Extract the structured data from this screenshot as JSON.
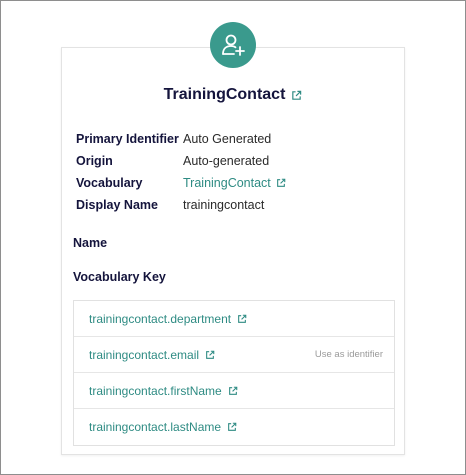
{
  "contact": {
    "title": "TrainingContact",
    "avatar_color": "#3a9a8d",
    "link_color": "#2e8b83"
  },
  "properties": [
    {
      "label": "Primary Identifier",
      "value": "Auto Generated"
    },
    {
      "label": "Origin",
      "value": "Auto-generated"
    },
    {
      "label": "Vocabulary",
      "value": "TrainingContact"
    },
    {
      "label": "Display Name",
      "value": "trainingcontact"
    }
  ],
  "sections": {
    "name_label": "Name",
    "vocabulary_key_label": "Vocabulary Key"
  },
  "vocabulary_keys": [
    {
      "key": "trainingcontact.department",
      "action": ""
    },
    {
      "key": "trainingcontact.email",
      "action": "Use as identifier"
    },
    {
      "key": "trainingcontact.firstName",
      "action": ""
    },
    {
      "key": "trainingcontact.lastName",
      "action": ""
    }
  ],
  "icons": {
    "avatar": "user-plus-icon",
    "external_link": "external-link-icon"
  }
}
